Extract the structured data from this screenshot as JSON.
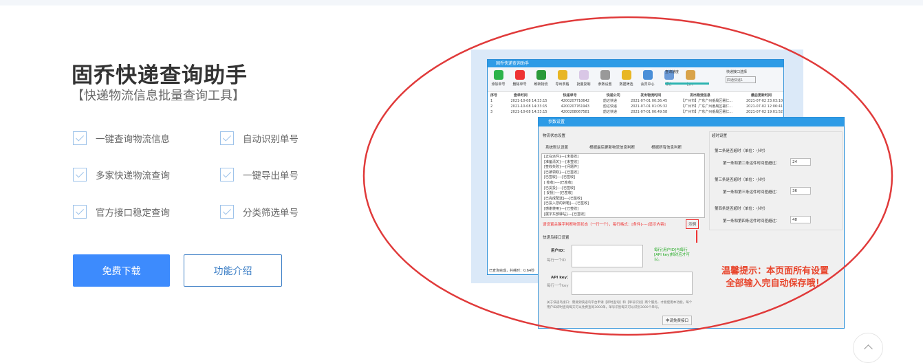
{
  "product": {
    "title": "固乔快递查询助手",
    "subtitle": "【快递物流信息批量查询工具】"
  },
  "features": [
    "一键查询物流信息",
    "自动识别单号",
    "多家快递物流查询",
    "一键导出单号",
    "官方接口稳定查询",
    "分类筛选单号"
  ],
  "buttons": {
    "download": "免费下载",
    "intro": "功能介绍"
  },
  "screenshot": {
    "window_title": "固乔快递查询助手",
    "toolbar": [
      "添加单号",
      "删除单号",
      "刷新物流",
      "导出表格",
      "批量复制",
      "参数设置",
      "数据筛选",
      "会员中心",
      "保存",
      "打开"
    ],
    "speed_label": "查询速度",
    "slow": "慢",
    "fast": "快",
    "api_label": "快递接口选择",
    "api_value": "四通快递1",
    "columns": [
      "序号",
      "查单时间",
      "快递单号",
      "快递公司",
      "发出物流时间",
      "发出物流信息",
      "最后更新时间"
    ],
    "rows": [
      [
        "1",
        "2021-10-08 14:33:15",
        "4200207710642",
        "韵达快递",
        "2021-07-01 00:36:45",
        "【广州市】广东广州番禺区署仁...",
        "2021-07-02 23:03:10"
      ],
      [
        "2",
        "2021-10-08 14:33:15",
        "4200207761943",
        "韵达快递",
        "2021-07-01 01:05:32",
        "【广州市】广东广州番禺区署仁...",
        "2021-07-02 12:06:41"
      ],
      [
        "3",
        "2021-10-08 14:33:15",
        "4200208067581",
        "韵达快递",
        "2021-07-01 00:49:58",
        "【广州市】广东广州番禺区署仁...",
        "2021-07-02 19:01:52"
      ]
    ],
    "status": "已查询完成，共耗时：0.64秒",
    "dialog": {
      "title": "参数设置",
      "logistics_group": "物流状态设置",
      "radios": [
        "系统默认设置",
        "根据最后更新物流信息判断",
        "根据所有信息判断"
      ],
      "rules": [
        "[正在派件]----[未签收]",
        "[准备清关]----[未签收]",
        "[签收失败]----[问题件]",
        "[已被领取]----[已签收]",
        "[已签收]----[已签收]",
        "[ 签收]----[已签收]",
        "[已妥投]----[已签收]",
        "[ 妥投]----[已签收]",
        "[已完成配送]----[已签收]",
        "[已投入您的转箱]----[已签收]",
        "[感谢使用]----[已签收]",
        "[展字东部驿站]----[已签收]"
      ],
      "hint": "请设置关键字判断物流状态（一行一个），每行格式：[条件]----[显示内容]",
      "example": "示例",
      "timeout_group": "超时设置",
      "timeouts": [
        {
          "head": "第二条是否超时（单位：小时）",
          "label": "第一条和第二条运件时间差超过：",
          "value": "24"
        },
        {
          "head": "第三条是否超时（单位：小时）",
          "label": "第一条和第三条运件时间差超过：",
          "value": "36"
        },
        {
          "head": "第四条是否超时（单位：小时）",
          "label": "第一条和第四条运件时间差超过：",
          "value": "48"
        }
      ],
      "api_group": "快递鸟接口设置",
      "user_id": "用户ID：",
      "user_id_hint": "每行一个ID",
      "api_key": "API key：",
      "api_key_hint": "每行一个key",
      "pair_hint": "每行[用户ID]与每行[API key]相对应才可以。",
      "note": "关于快递鸟接口：需要到快递鸟平台申请【即时查询】和【单号识别】两个服务，才能使用本功能，每个用户ID即时查询每天可以免费查询3000单，单号识别每天可以识别3000个单号。",
      "apply": "申请免费接口"
    },
    "tip": [
      "温馨提示：本页面所有设置",
      "全部输入完自动保存哦！"
    ]
  },
  "colors": {
    "accent": "#3d8bfd",
    "annotation": "#e03a3a"
  }
}
